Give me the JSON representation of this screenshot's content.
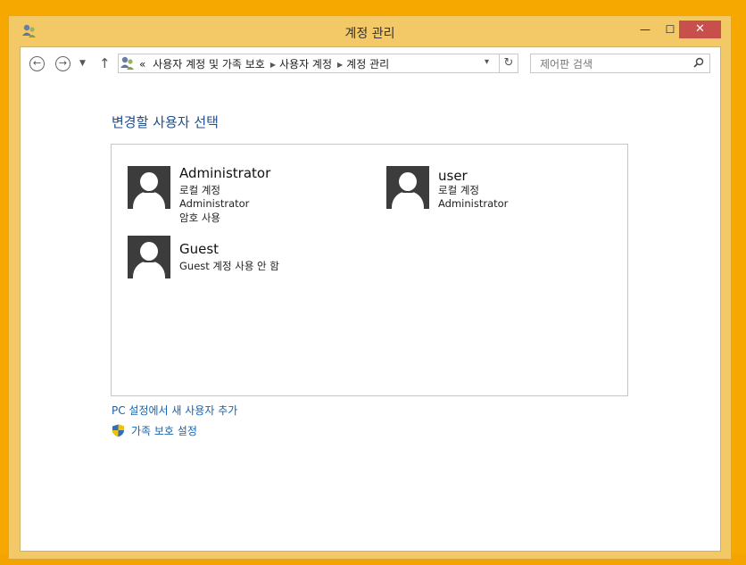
{
  "window": {
    "title": "계정 관리",
    "app_icon": "user-accounts-icon",
    "controls": {
      "minimize": "—",
      "maximize": "☐",
      "close": "✕"
    }
  },
  "nav": {
    "back_glyph": "←",
    "forward_glyph": "→",
    "recent_glyph": "▼",
    "up_glyph": "↑",
    "breadcrumb_overflow": "«",
    "breadcrumbs": [
      "사용자 계정 및 가족 보호",
      "사용자 계정",
      "계정 관리"
    ],
    "separator": "▶",
    "refresh_glyph": "↻",
    "dropdown_glyph": "▾",
    "search": {
      "placeholder": "제어판 검색",
      "value": ""
    }
  },
  "main": {
    "heading": "변경할 사용자 선택",
    "accounts": [
      {
        "name": "Administrator",
        "lines": [
          "로컬 계정",
          "Administrator",
          "암호 사용"
        ]
      },
      {
        "name": "user",
        "lines": [
          "로컬 계정",
          "Administrator"
        ]
      },
      {
        "name": "Guest",
        "lines": [
          "Guest 계정 사용 안 함"
        ]
      }
    ],
    "links": {
      "add_user": "PC 설정에서 새 사용자 추가",
      "family_safety": "가족 보호 설정"
    }
  },
  "colors": {
    "accent": "#1e4e8c",
    "link": "#1464b4",
    "frame": "#f3c866",
    "close": "#c7504d"
  }
}
